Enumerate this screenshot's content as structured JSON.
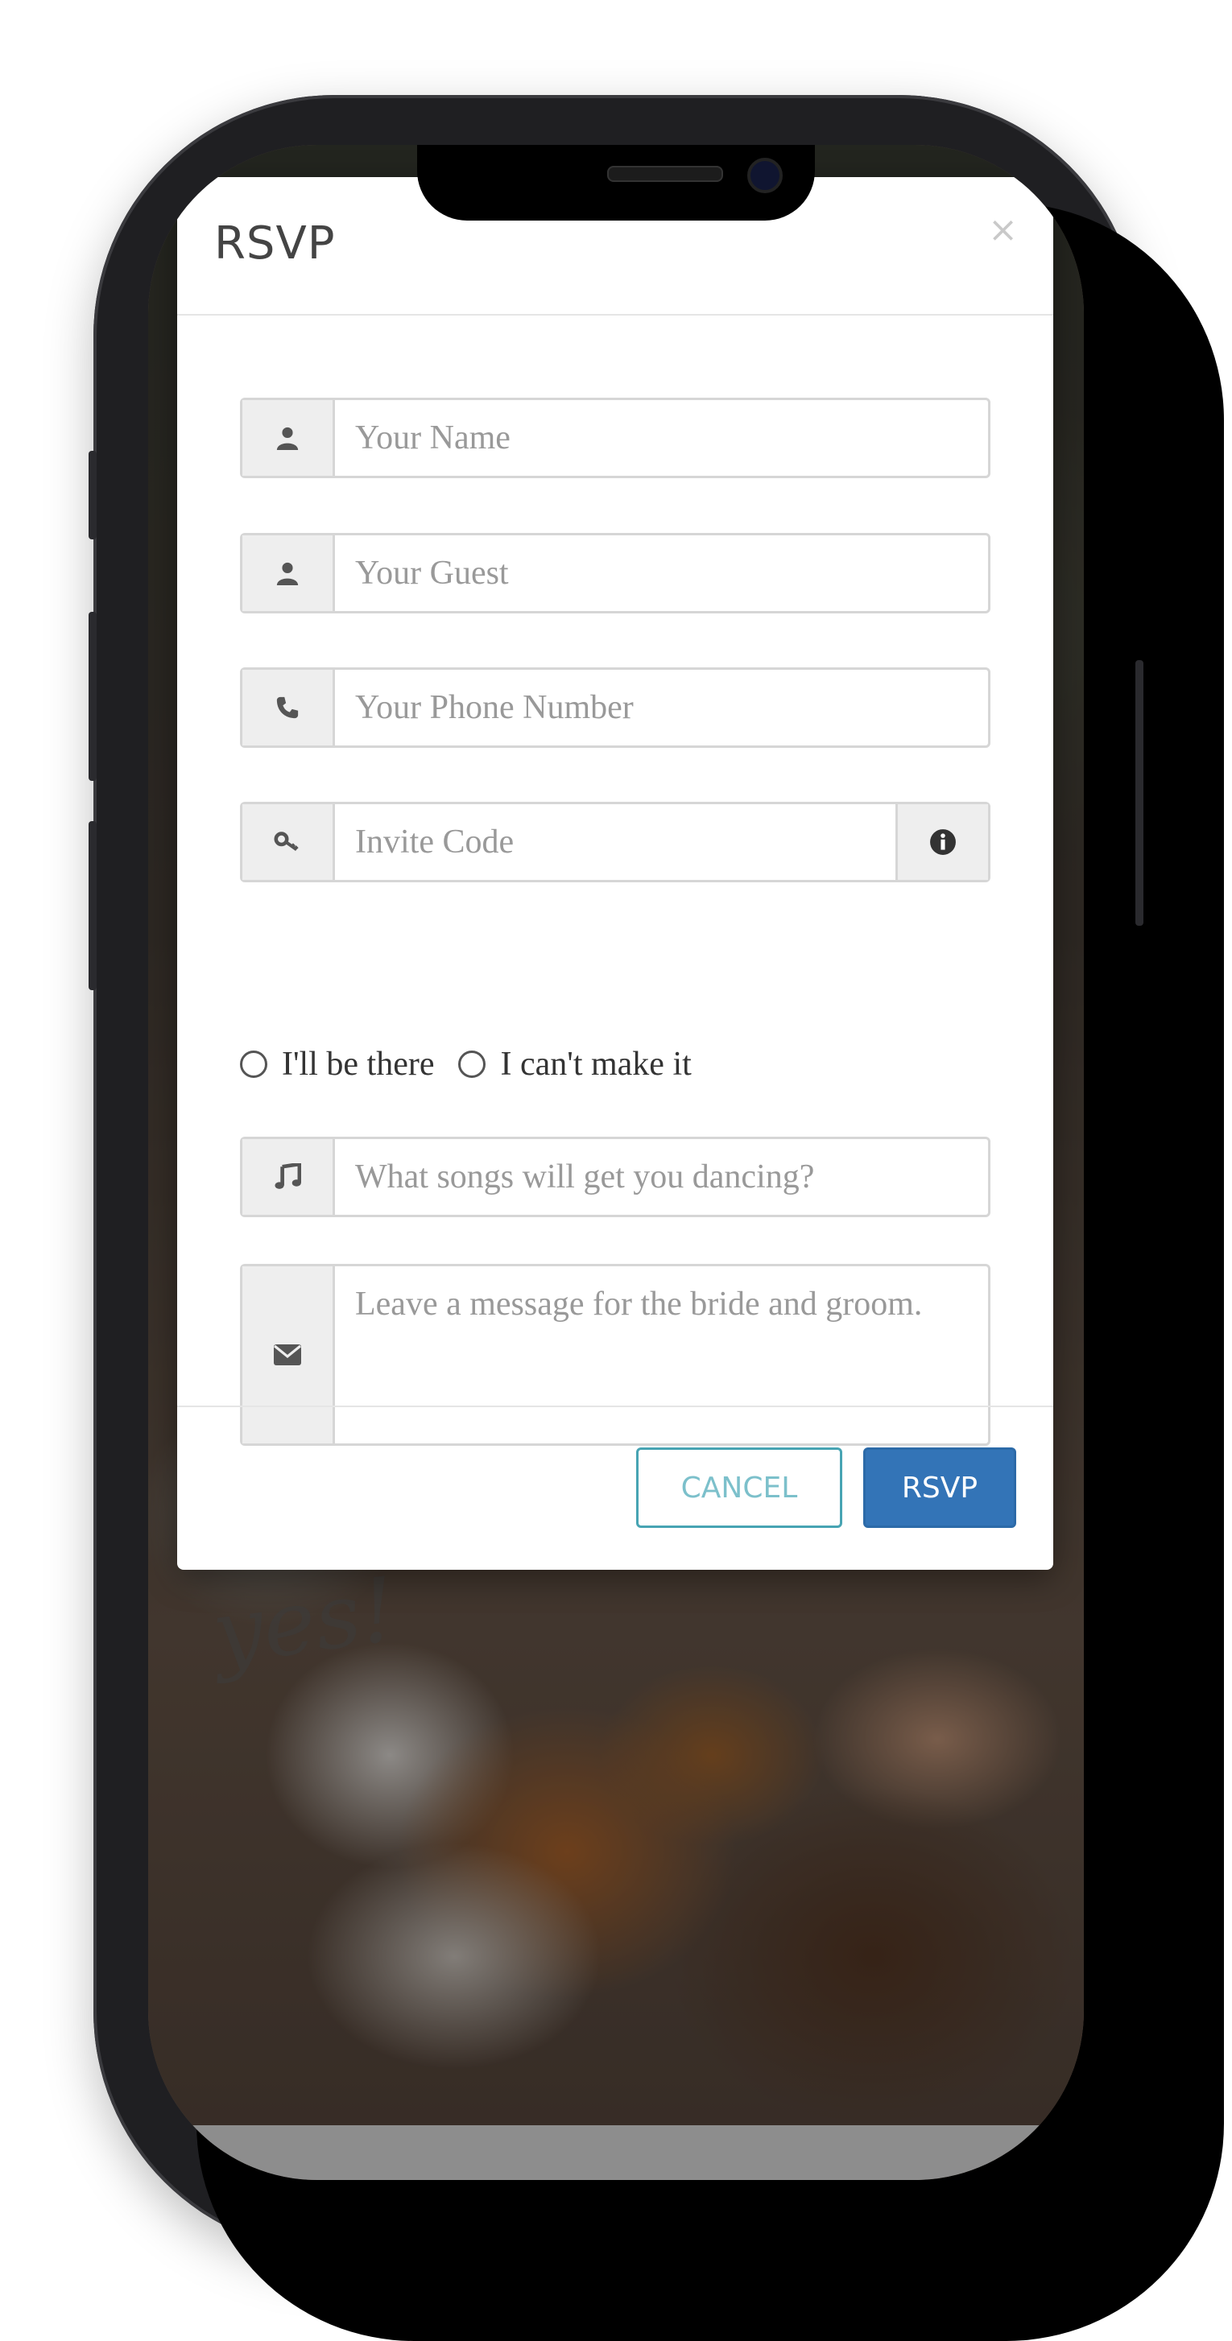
{
  "modal": {
    "title": "RSVP",
    "close_symbol": "×"
  },
  "form": {
    "name_placeholder": "Your Name",
    "guest_placeholder": "Your Guest",
    "phone_placeholder": "Your Phone Number",
    "invite_placeholder": "Invite Code",
    "attend_yes_label": "I'll be there",
    "attend_no_label": "I can't make it",
    "songs_placeholder": "What songs will get you dancing?",
    "message_placeholder": "Leave a message for the bride and groom."
  },
  "icons": {
    "name": "user-icon",
    "guest": "user-icon",
    "phone": "phone-icon",
    "invite": "key-icon",
    "invite_info": "info-icon",
    "songs": "music-note-icon",
    "message": "envelope-icon"
  },
  "footer": {
    "cancel_label": "CANCEL",
    "rsvp_label": "RSVP"
  },
  "colors": {
    "primary": "#3374b7",
    "cancel_border": "#47a4b3"
  }
}
